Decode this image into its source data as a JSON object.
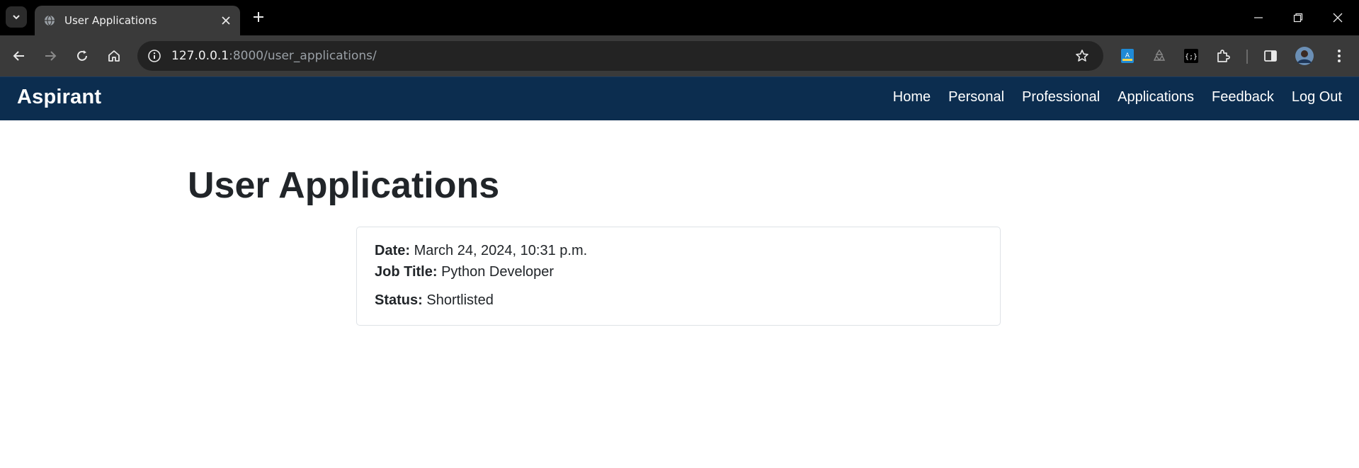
{
  "browser": {
    "tab_title": "User Applications",
    "url_host": "127.0.0.1",
    "url_rest": ":8000/user_applications/"
  },
  "site": {
    "brand": "Aspirant",
    "nav": [
      "Home",
      "Personal",
      "Professional",
      "Applications",
      "Feedback",
      "Log Out"
    ],
    "colors": {
      "navbar": "#0c2d4f",
      "text": "#212529"
    }
  },
  "main": {
    "title": "User Applications",
    "applications": [
      {
        "date_label": "Date:",
        "date": "March 24, 2024, 10:31 p.m.",
        "job_title_label": "Job Title:",
        "job_title": "Python Developer",
        "status_label": "Status:",
        "status": "Shortlisted"
      }
    ]
  }
}
